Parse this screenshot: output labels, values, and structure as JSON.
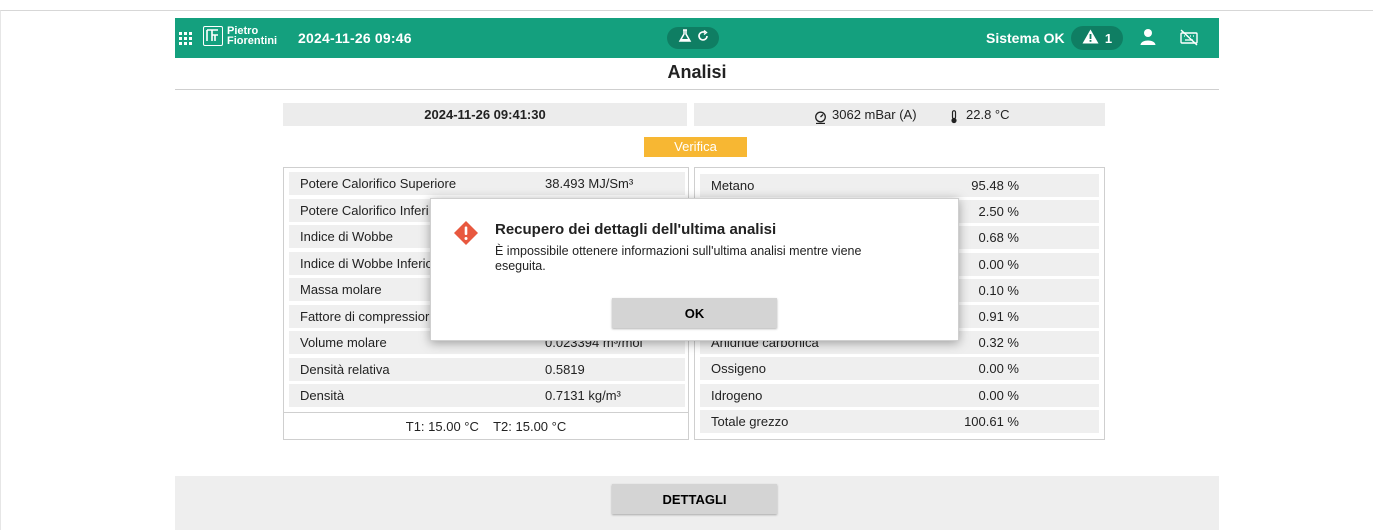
{
  "header": {
    "brand_line1": "Pietro",
    "brand_line2": "Fiorentini",
    "datetime": "2024-11-26 09:46",
    "status": "Sistema OK",
    "alarm_count": "1",
    "icons": [
      "apps-grid-icon",
      "flask-icon",
      "refresh-icon",
      "warning-icon",
      "user-icon",
      "keyboard-off-icon"
    ],
    "accent_color": "#14a07e"
  },
  "page": {
    "title": "Analisi",
    "analysis_datetime": "2024-11-26 09:41:30",
    "pressure": "3062 mBar (A)",
    "temperature": "22.8 °C",
    "verify_label": "Verifica",
    "verify_color": "#f7b733"
  },
  "properties": [
    {
      "label": "Potere Calorifico Superiore",
      "value": "38.493 MJ/Sm³"
    },
    {
      "label": "Potere Calorifico Inferi",
      "value": ""
    },
    {
      "label": "Indice di Wobbe",
      "value": ""
    },
    {
      "label": "Indice di Wobbe Inferio",
      "value": ""
    },
    {
      "label": "Massa molare",
      "value": ""
    },
    {
      "label": "Fattore di compressior",
      "value": ""
    },
    {
      "label": "Volume molare",
      "value": "0.023394 m³/mol"
    },
    {
      "label": "Densità relativa",
      "value": "0.5819"
    },
    {
      "label": "Densità",
      "value": "0.7131 kg/m³"
    }
  ],
  "reference_temps": "T1: 15.00 °C    T2: 15.00 °C",
  "components": [
    {
      "label": "Metano",
      "value": "95.48 %"
    },
    {
      "label": "",
      "value": "2.50 %"
    },
    {
      "label": "",
      "value": "0.68 %"
    },
    {
      "label": "",
      "value": "0.00 %"
    },
    {
      "label": "",
      "value": "0.10 %"
    },
    {
      "label": "",
      "value": "0.91 %"
    },
    {
      "label": "Anidride carbonica",
      "value": "0.32 %"
    },
    {
      "label": "Ossigeno",
      "value": "0.00 %"
    },
    {
      "label": "Idrogeno",
      "value": "0.00 %"
    },
    {
      "label": "Totale grezzo",
      "value": "100.61 %"
    }
  ],
  "dialog": {
    "title": "Recupero dei dettagli dell'ultima analisi",
    "message": "È impossibile ottenere informazioni sull'ultima analisi mentre viene eseguita.",
    "ok_label": "OK",
    "warning_color": "#e8583f"
  },
  "footer": {
    "details_label": "DETTAGLI"
  }
}
